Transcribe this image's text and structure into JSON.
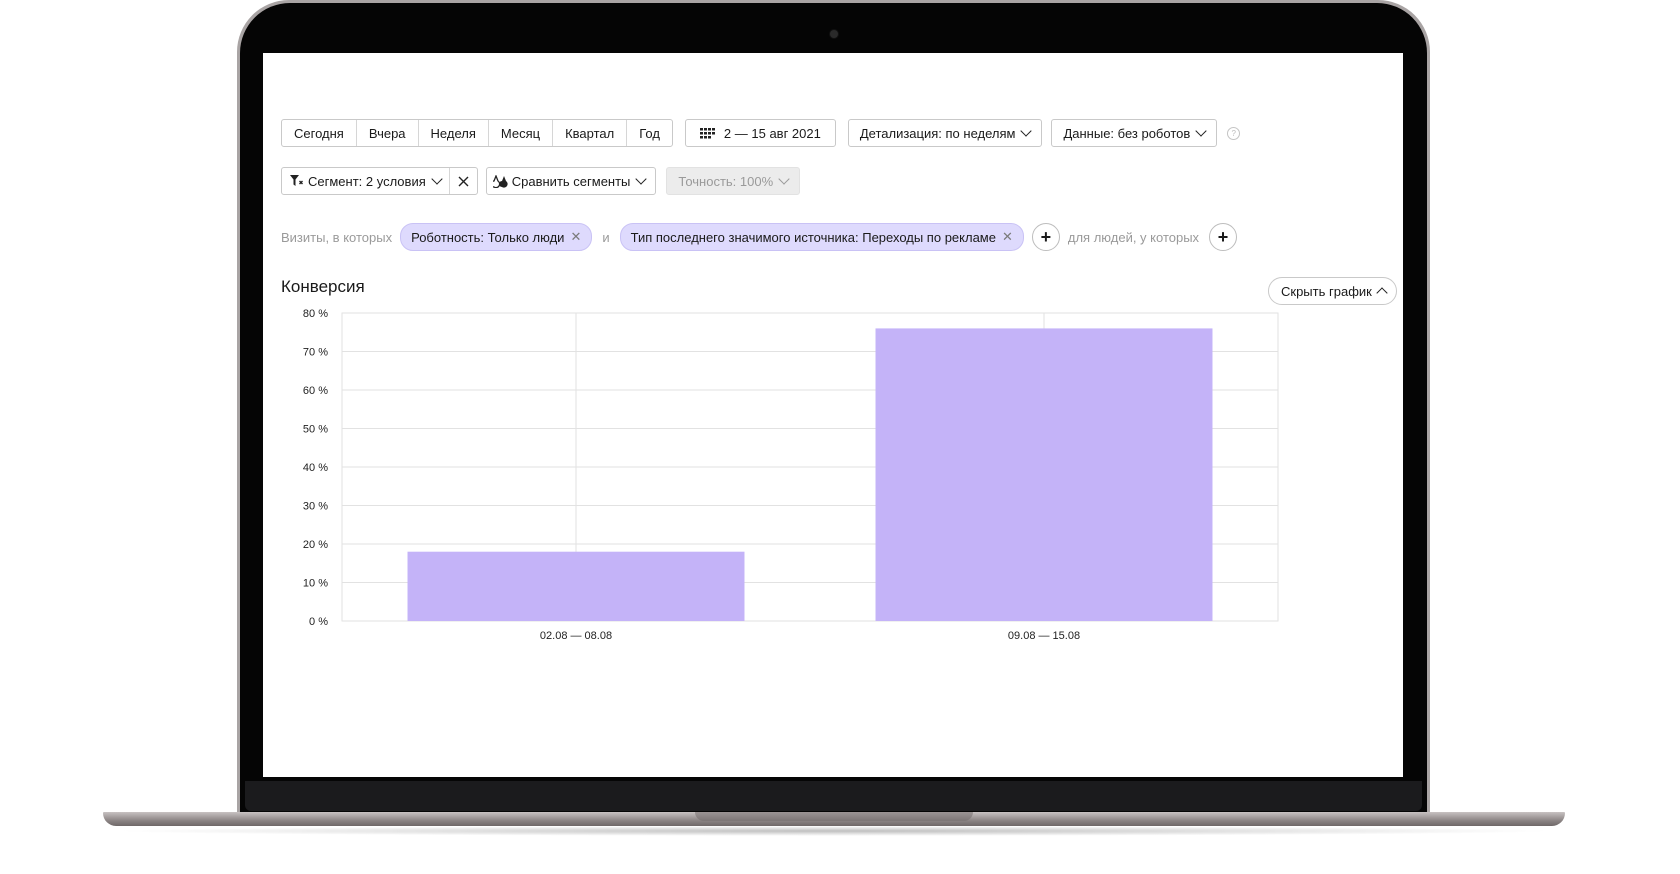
{
  "toolbar": {
    "periods": [
      "Сегодня",
      "Вчера",
      "Неделя",
      "Месяц",
      "Квартал",
      "Год"
    ],
    "date_range": "2 — 15 авг 2021",
    "detail_label": "Детализация: по неделям",
    "data_label": "Данные: без роботов",
    "help_glyph": "?"
  },
  "segment": {
    "segment_label": "Сегмент: 2 условия",
    "compare_label": "Сравнить сегменты",
    "accuracy_label": "Точность: 100%"
  },
  "filters": {
    "visits_prefix": "Визиты, в которых",
    "chip1": "Роботность: Только люди",
    "and_label": "и",
    "chip2": "Тип последнего значимого источника: Переходы по рекламе",
    "people_label": "для людей, у которых"
  },
  "report": {
    "title": "Конверсия",
    "hide_chart_label": "Скрыть график"
  },
  "colors": {
    "bar": "#c4b3f8",
    "chip_bg": "#dedafd",
    "grid": "#e2e2e2"
  },
  "icons": [
    "calendar-icon",
    "filter-icon",
    "compare-icon",
    "close-icon",
    "plus-icon",
    "help-icon",
    "chevron-down-icon",
    "chevron-up-icon"
  ],
  "chart_data": {
    "type": "bar",
    "categories": [
      "02.08 — 08.08",
      "09.08 — 15.08"
    ],
    "values": [
      18,
      76
    ],
    "ylim": [
      0,
      80
    ],
    "yticks": [
      0,
      10,
      20,
      30,
      40,
      50,
      60,
      70,
      80
    ],
    "ytick_suffix": " %",
    "grid": true,
    "legend": "none"
  }
}
